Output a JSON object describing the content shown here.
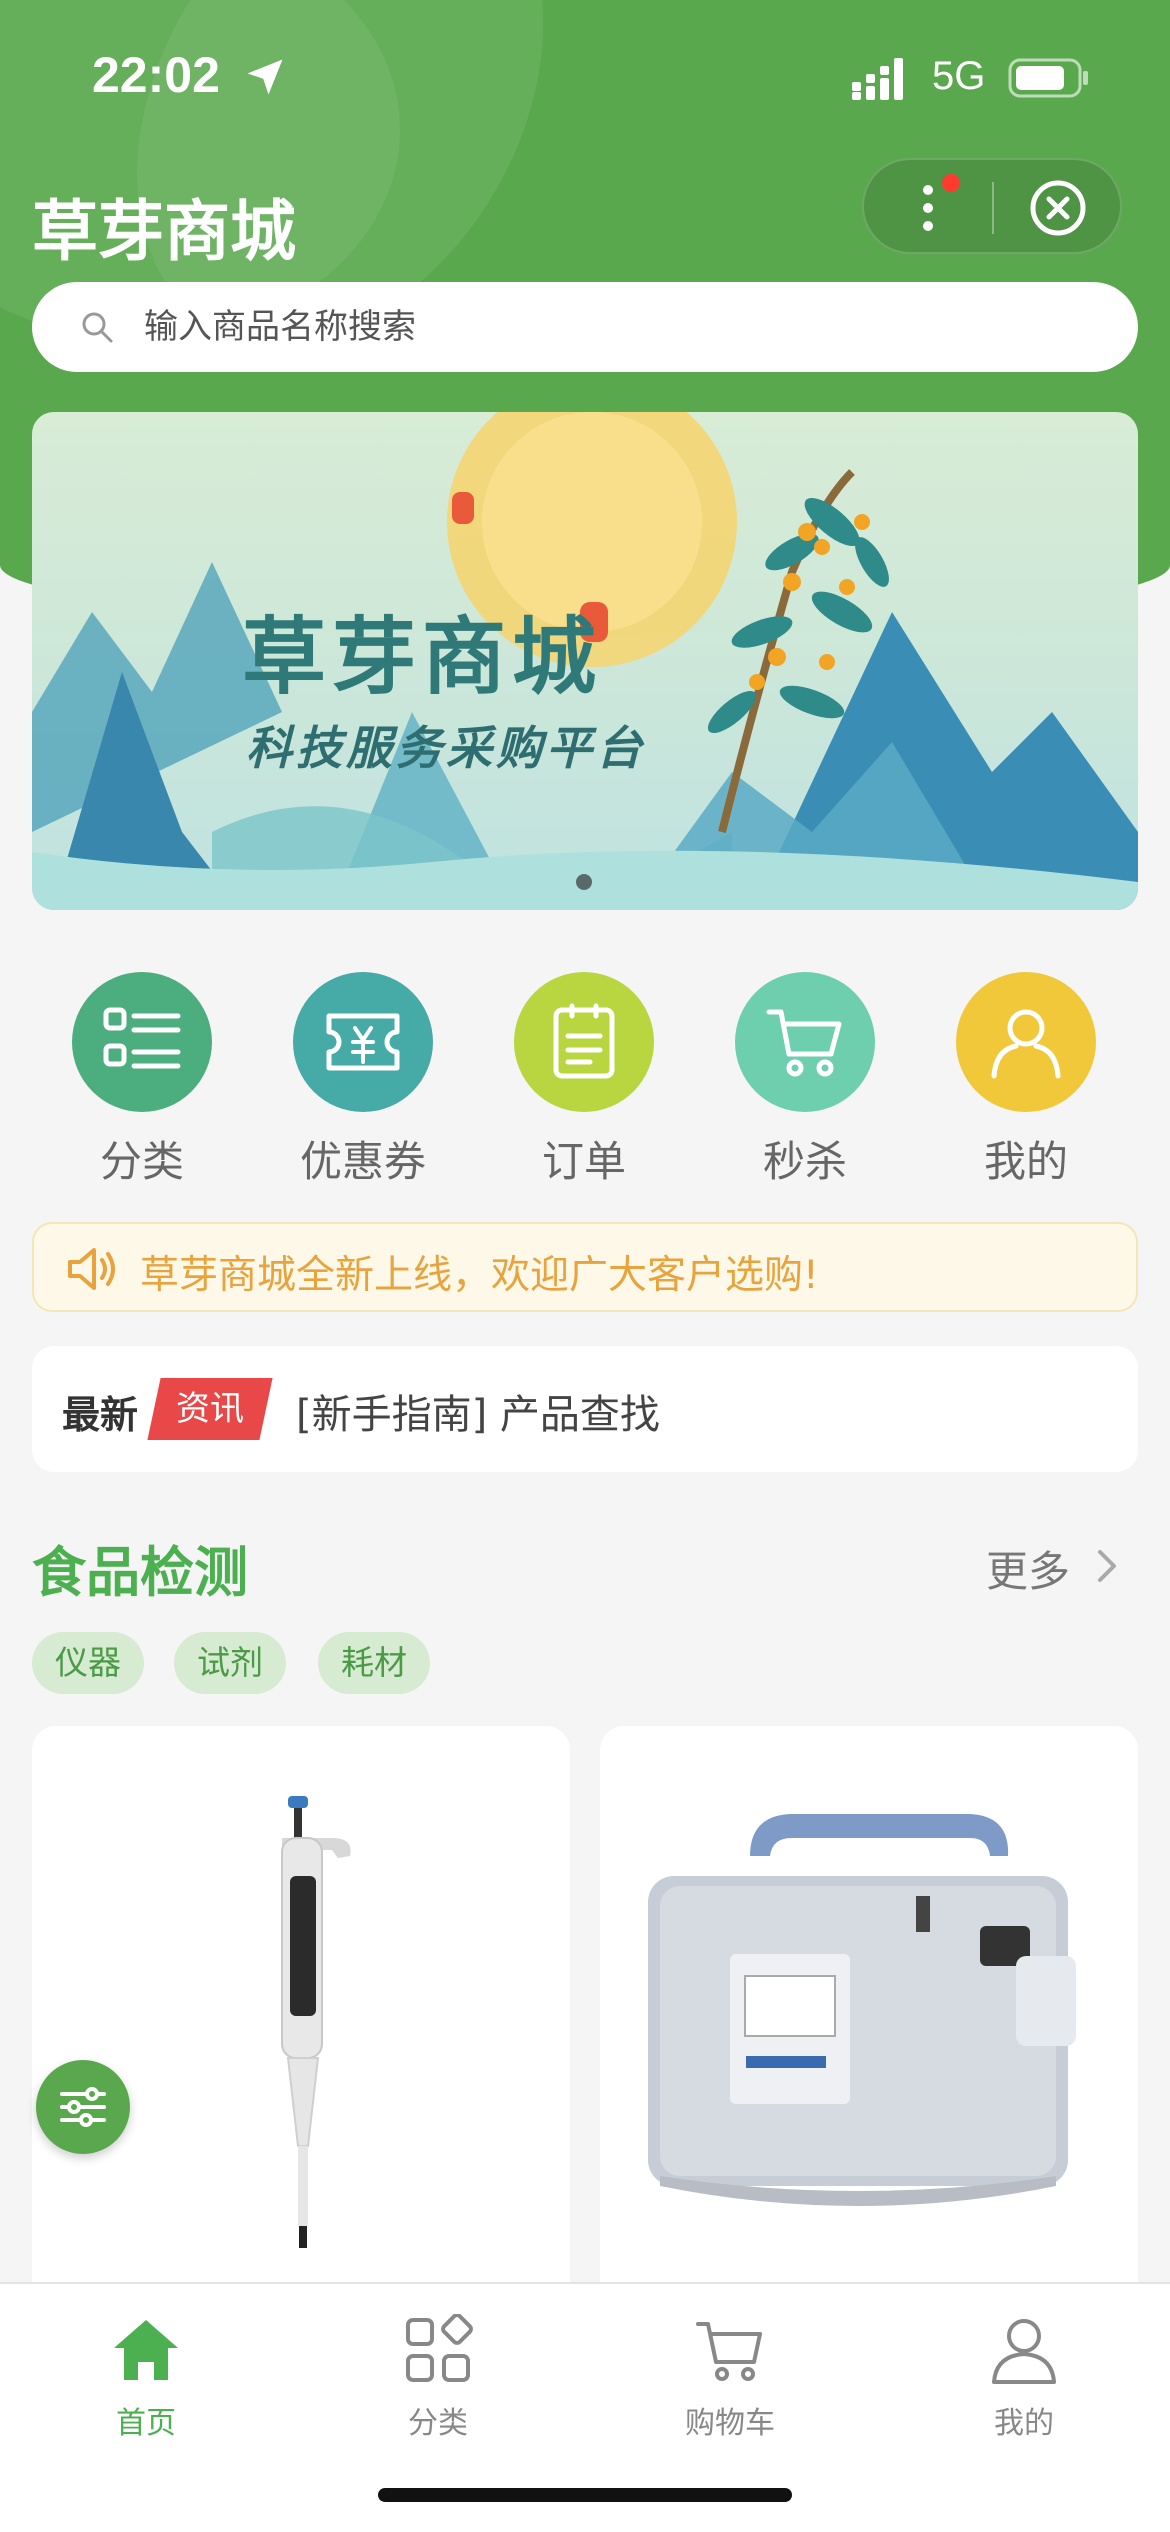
{
  "status_bar": {
    "time": "22:02",
    "network": "5G"
  },
  "header": {
    "title": "草芽商城"
  },
  "search": {
    "placeholder": "输入商品名称搜索"
  },
  "banner": {
    "title": "草芽商城",
    "subtitle": "科技服务采购平台"
  },
  "quick_menu": [
    {
      "label": "分类",
      "icon": "list-icon",
      "color": "#4cae7e"
    },
    {
      "label": "优惠券",
      "icon": "coupon-icon",
      "color": "#46aaa6"
    },
    {
      "label": "订单",
      "icon": "order-icon",
      "color": "#b9d640"
    },
    {
      "label": "秒杀",
      "icon": "cart-icon",
      "color": "#6dcfae"
    },
    {
      "label": "我的",
      "icon": "user-icon",
      "color": "#f1c83a"
    }
  ],
  "notice": {
    "text": "草芽商城全新上线，欢迎广大客户选购!"
  },
  "news": {
    "latest": "最新",
    "tag": "资讯",
    "text": "[新手指南] 产品查找"
  },
  "section": {
    "title": "食品检测",
    "more": "更多",
    "chips": [
      "仪器",
      "试剂",
      "耗材"
    ]
  },
  "products": [
    {
      "name": "pipette",
      "image": "pipette-image"
    },
    {
      "name": "vacuum-pump",
      "image": "vacuum-pump-image"
    }
  ],
  "tabbar": [
    {
      "label": "首页",
      "icon": "home-icon",
      "active": true
    },
    {
      "label": "分类",
      "icon": "grid-icon",
      "active": false
    },
    {
      "label": "购物车",
      "icon": "cart-icon",
      "active": false
    },
    {
      "label": "我的",
      "icon": "user-icon",
      "active": false
    }
  ],
  "colors": {
    "brand_green": "#5aa84e",
    "notice_text": "#e8a33d",
    "tag_red": "#e94848",
    "active_tab": "#4caf50"
  }
}
